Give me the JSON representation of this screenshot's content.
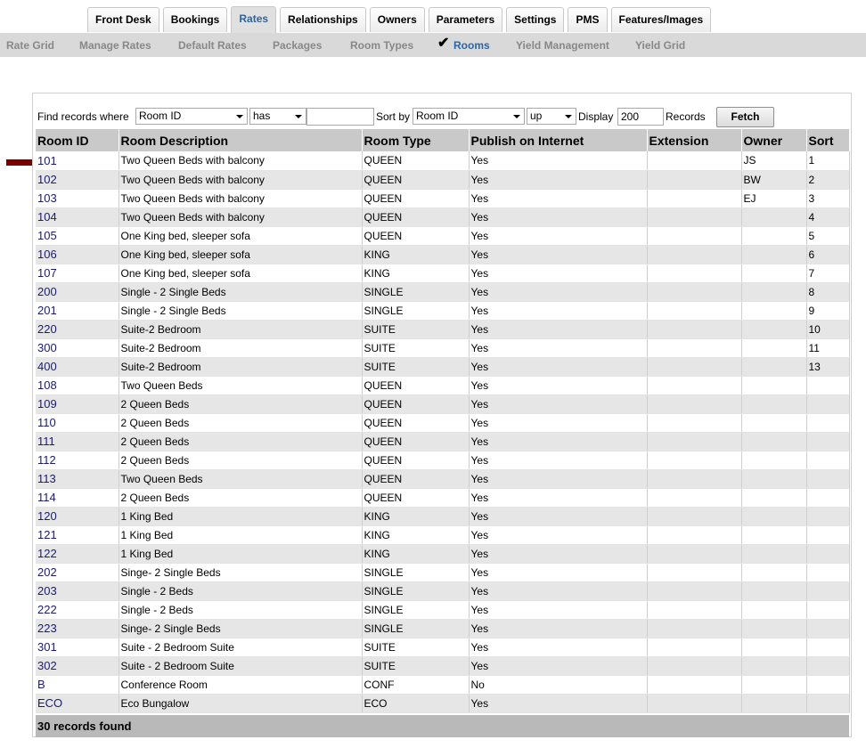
{
  "tabs": [
    "Front Desk",
    "Bookings",
    "Rates",
    "Relationships",
    "Owners",
    "Parameters",
    "Settings",
    "PMS",
    "Features/Images"
  ],
  "active_tab": "Rates",
  "subnav": [
    "Rate Grid",
    "Manage Rates",
    "Default Rates",
    "Packages",
    "Room Types",
    "Rooms",
    "Yield Management",
    "Yield Grid"
  ],
  "active_subnav": "Rooms",
  "filter": {
    "find_label": "Find records where",
    "field_value": "Room ID",
    "operator_value": "has",
    "search_value": "",
    "sort_label": "Sort by",
    "sort_value": "Room ID",
    "direction_value": "up",
    "display_label": "Display",
    "display_value": "200",
    "records_label": "Records",
    "fetch_label": "Fetch"
  },
  "table": {
    "headers": [
      "Room ID",
      "Room Description",
      "Room Type",
      "Publish on Internet",
      "Extension",
      "Owner",
      "Sort"
    ],
    "rows": [
      [
        "101",
        "Two Queen Beds with balcony",
        "QUEEN",
        "Yes",
        "",
        "JS",
        "1"
      ],
      [
        "102",
        "Two Queen Beds with balcony",
        "QUEEN",
        "Yes",
        "",
        "BW",
        "2"
      ],
      [
        "103",
        "Two Queen Beds with balcony",
        "QUEEN",
        "Yes",
        "",
        "EJ",
        "3"
      ],
      [
        "104",
        "Two Queen Beds with balcony",
        "QUEEN",
        "Yes",
        "",
        "",
        "4"
      ],
      [
        "105",
        "One King bed, sleeper sofa",
        "QUEEN",
        "Yes",
        "",
        "",
        "5"
      ],
      [
        "106",
        "One King bed, sleeper sofa",
        "KING",
        "Yes",
        "",
        "",
        "6"
      ],
      [
        "107",
        "One King bed, sleeper sofa",
        "KING",
        "Yes",
        "",
        "",
        "7"
      ],
      [
        "200",
        "Single - 2 Single Beds",
        "SINGLE",
        "Yes",
        "",
        "",
        "8"
      ],
      [
        "201",
        "Single - 2 Single Beds",
        "SINGLE",
        "Yes",
        "",
        "",
        "9"
      ],
      [
        "220",
        "Suite-2 Bedroom",
        "SUITE",
        "Yes",
        "",
        "",
        "10"
      ],
      [
        "300",
        "Suite-2 Bedroom",
        "SUITE",
        "Yes",
        "",
        "",
        "11"
      ],
      [
        "400",
        "Suite-2 Bedroom",
        "SUITE",
        "Yes",
        "",
        "",
        "13"
      ],
      [
        "108",
        "Two Queen Beds",
        "QUEEN",
        "Yes",
        "",
        "",
        ""
      ],
      [
        "109",
        "2 Queen Beds",
        "QUEEN",
        "Yes",
        "",
        "",
        ""
      ],
      [
        "110",
        "2 Queen Beds",
        "QUEEN",
        "Yes",
        "",
        "",
        ""
      ],
      [
        "111",
        "2 Queen Beds",
        "QUEEN",
        "Yes",
        "",
        "",
        ""
      ],
      [
        "112",
        "2 Queen Beds",
        "QUEEN",
        "Yes",
        "",
        "",
        ""
      ],
      [
        "113",
        "Two Queen Beds",
        "QUEEN",
        "Yes",
        "",
        "",
        ""
      ],
      [
        "114",
        "2 Queen Beds",
        "QUEEN",
        "Yes",
        "",
        "",
        ""
      ],
      [
        "120",
        "1 King Bed",
        "KING",
        "Yes",
        "",
        "",
        ""
      ],
      [
        "121",
        "1 King Bed",
        "KING",
        "Yes",
        "",
        "",
        ""
      ],
      [
        "122",
        "1 King Bed",
        "KING",
        "Yes",
        "",
        "",
        ""
      ],
      [
        "202",
        "Singe- 2 Single Beds",
        "SINGLE",
        "Yes",
        "",
        "",
        ""
      ],
      [
        "203",
        "Single - 2 Beds",
        "SINGLE",
        "Yes",
        "",
        "",
        ""
      ],
      [
        "222",
        "Single - 2 Beds",
        "SINGLE",
        "Yes",
        "",
        "",
        ""
      ],
      [
        "223",
        "Singe- 2 Single Beds",
        "SINGLE",
        "Yes",
        "",
        "",
        ""
      ],
      [
        "301",
        "Suite - 2 Bedroom Suite",
        "SUITE",
        "Yes",
        "",
        "",
        ""
      ],
      [
        "302",
        "Suite - 2 Bedroom Suite",
        "SUITE",
        "Yes",
        "",
        "",
        ""
      ],
      [
        "B",
        "Conference Room",
        "CONF",
        "No",
        "",
        "",
        ""
      ],
      [
        "ECO",
        "Eco Bungalow",
        "ECO",
        "Yes",
        "",
        "",
        ""
      ]
    ]
  },
  "footer_text": "30 records found",
  "colors": {
    "accent": "#2a66a8",
    "link": "#1a1a7a",
    "marker": "#7a0000"
  }
}
